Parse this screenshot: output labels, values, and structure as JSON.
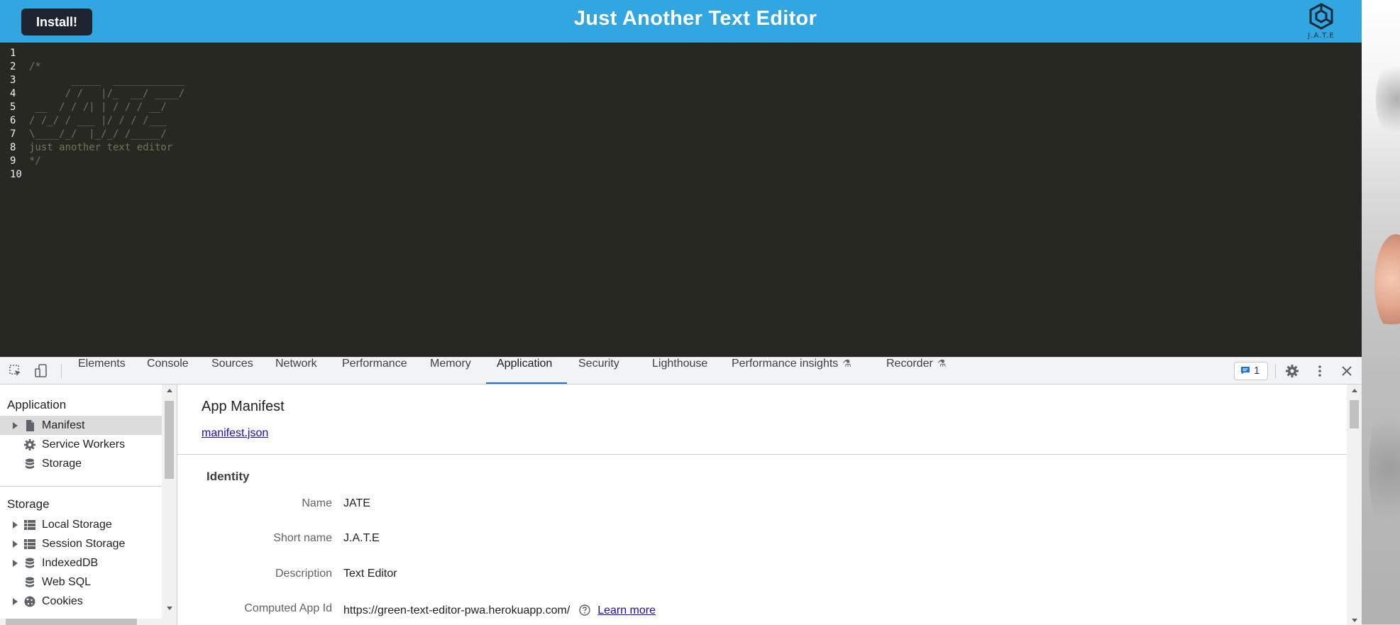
{
  "app": {
    "install_label": "Install!",
    "title": "Just Another Text Editor",
    "logo_text": "J.A.T.E",
    "header_color": "#31a6e0"
  },
  "editor": {
    "lines": [
      {
        "num": "1",
        "code": ""
      },
      {
        "num": "2",
        "code": "/*"
      },
      {
        "num": "3",
        "code": "       _____  ____________"
      },
      {
        "num": "4",
        "code": "      / /   |/_  __/ ____/"
      },
      {
        "num": "5",
        "code": " __  / / /| | / / / __/"
      },
      {
        "num": "6",
        "code": "/ /_/ / ___ |/ / / /___"
      },
      {
        "num": "7",
        "code": "\\____/_/  |_/_/ /_____/"
      },
      {
        "num": "8",
        "code": "just another text editor"
      },
      {
        "num": "9",
        "code": "*/"
      },
      {
        "num": "10",
        "code": ""
      }
    ],
    "background": "#272822"
  },
  "devtools": {
    "tabs": [
      {
        "label": "Elements",
        "active": false
      },
      {
        "label": "Console",
        "active": false
      },
      {
        "label": "Sources",
        "active": false
      },
      {
        "label": "Network",
        "active": false
      },
      {
        "label": "Performance",
        "active": false
      },
      {
        "label": "Memory",
        "active": false
      },
      {
        "label": "Application",
        "active": true
      },
      {
        "label": "Security",
        "active": false
      },
      {
        "label": "Lighthouse",
        "active": false
      },
      {
        "label": "Performance insights",
        "active": false,
        "experimental": true
      },
      {
        "label": "Recorder",
        "active": false,
        "experimental": true
      }
    ],
    "issues_count": "1",
    "sidebar": {
      "application_header": "Application",
      "application_items": [
        {
          "label": "Manifest",
          "icon": "file-icon",
          "selected": true,
          "expandable": true
        },
        {
          "label": "Service Workers",
          "icon": "gear-icon",
          "selected": false,
          "expandable": false
        },
        {
          "label": "Storage",
          "icon": "database-icon",
          "selected": false,
          "expandable": false
        }
      ],
      "storage_header": "Storage",
      "storage_items": [
        {
          "label": "Local Storage",
          "icon": "table-icon",
          "expandable": true
        },
        {
          "label": "Session Storage",
          "icon": "table-icon",
          "expandable": true
        },
        {
          "label": "IndexedDB",
          "icon": "database-icon",
          "expandable": true
        },
        {
          "label": "Web SQL",
          "icon": "database-icon",
          "expandable": false
        },
        {
          "label": "Cookies",
          "icon": "cookie-icon",
          "expandable": true
        }
      ]
    },
    "main": {
      "title": "App Manifest",
      "manifest_link": "manifest.json",
      "identity_header": "Identity",
      "rows": [
        {
          "label": "Name",
          "value": "JATE"
        },
        {
          "label": "Short name",
          "value": "J.A.T.E"
        },
        {
          "label": "Description",
          "value": "Text Editor"
        },
        {
          "label": "Computed App Id",
          "value": "https://green-text-editor-pwa.herokuapp.com/"
        }
      ],
      "learn_more": "Learn more"
    }
  }
}
